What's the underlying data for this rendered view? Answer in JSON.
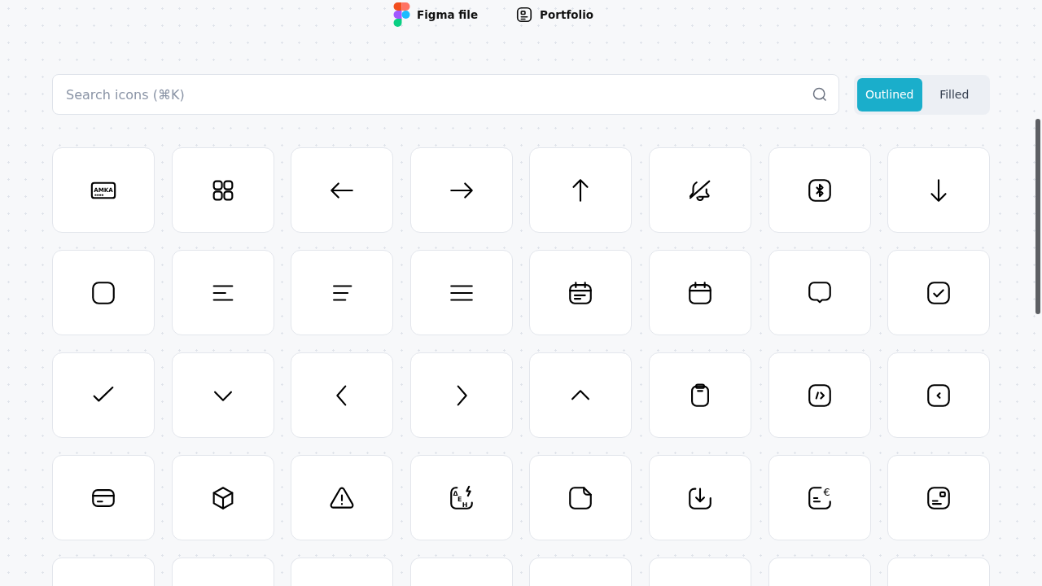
{
  "top_links": [
    {
      "kind": "figma",
      "label": "Figma file"
    },
    {
      "kind": "portfolio",
      "label": "Portfolio"
    }
  ],
  "search": {
    "placeholder": "Search icons (⌘K)"
  },
  "style_toggle": [
    {
      "label": "Outlined",
      "selected": true
    },
    {
      "label": "Filled",
      "selected": false
    }
  ],
  "tiles": [
    {
      "kind": "amka-card",
      "text": "AMKA"
    },
    {
      "kind": "grid"
    },
    {
      "kind": "arrow-left"
    },
    {
      "kind": "arrow-right"
    },
    {
      "kind": "arrow-up"
    },
    {
      "kind": "bell-off"
    },
    {
      "kind": "bluetooth"
    },
    {
      "kind": "arrow-down"
    },
    {
      "kind": "square"
    },
    {
      "kind": "align-left"
    },
    {
      "kind": "align-steps"
    },
    {
      "kind": "menu"
    },
    {
      "kind": "calendar-text"
    },
    {
      "kind": "calendar"
    },
    {
      "kind": "message"
    },
    {
      "kind": "checkbox"
    },
    {
      "kind": "check"
    },
    {
      "kind": "chevron-down"
    },
    {
      "kind": "chevron-left"
    },
    {
      "kind": "chevron-right"
    },
    {
      "kind": "chevron-up"
    },
    {
      "kind": "clipboard"
    },
    {
      "kind": "code-square"
    },
    {
      "kind": "chevron-left-square"
    },
    {
      "kind": "credit-card"
    },
    {
      "kind": "cube"
    },
    {
      "kind": "warning"
    },
    {
      "kind": "deh-bolt",
      "text": "Δ E H"
    },
    {
      "kind": "note"
    },
    {
      "kind": "download-box"
    },
    {
      "kind": "euro-card",
      "text": "€"
    },
    {
      "kind": "id-square"
    },
    {
      "kind": "cut"
    },
    {
      "kind": "cut"
    },
    {
      "kind": "cut"
    },
    {
      "kind": "cut"
    },
    {
      "kind": "cut"
    },
    {
      "kind": "cut"
    },
    {
      "kind": "cut"
    },
    {
      "kind": "cut"
    }
  ]
}
